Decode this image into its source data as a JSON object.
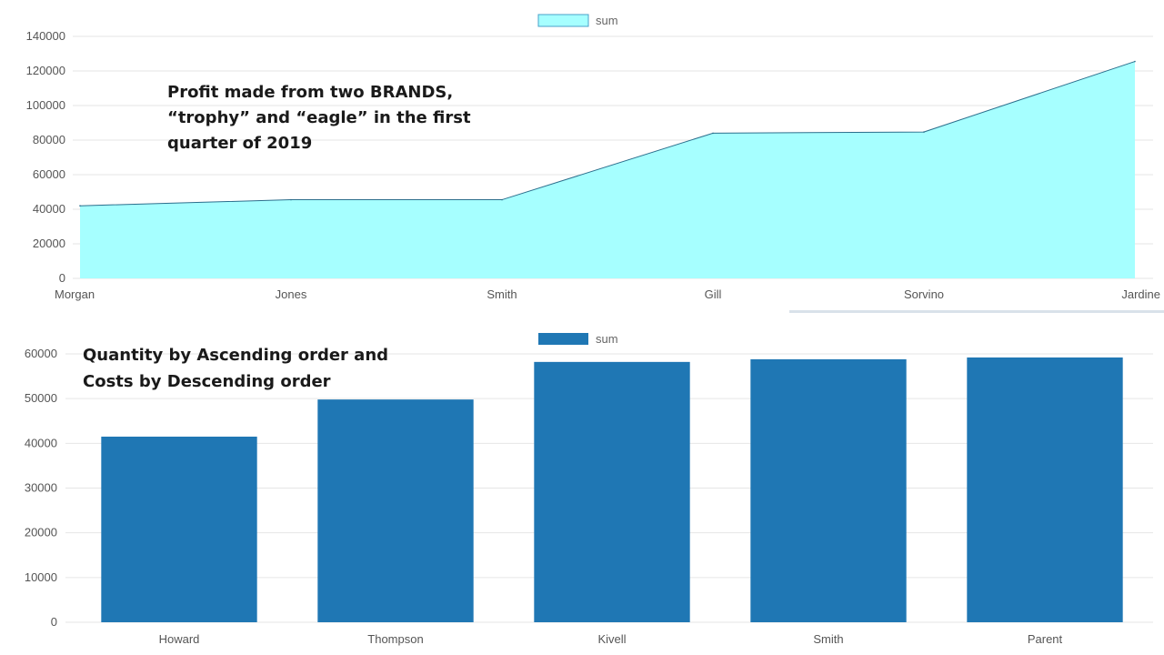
{
  "chart_data": [
    {
      "type": "area",
      "title": "",
      "legend": {
        "label": "sum",
        "placement": "top-center"
      },
      "categories": [
        "Morgan",
        "Jones",
        "Smith",
        "Gill",
        "Sorvino",
        "Jardine"
      ],
      "series": [
        {
          "name": "sum",
          "values": [
            42000,
            45500,
            45500,
            84000,
            84700,
            125500
          ]
        }
      ],
      "ylim": [
        0,
        140000
      ],
      "yticks": [
        0,
        20000,
        40000,
        60000,
        80000,
        100000,
        120000,
        140000
      ],
      "grid": true,
      "fill_color": "#a6ffff",
      "line_color": "#2b6e8c",
      "annotation": [
        "Profit made from two BRANDS,",
        "“trophy” and “eagle” in the first",
        "quarter of 2019"
      ]
    },
    {
      "type": "bar",
      "title": "",
      "legend": {
        "label": "sum",
        "placement": "top-center"
      },
      "categories": [
        "Howard",
        "Thompson",
        "Kivell",
        "Smith",
        "Parent"
      ],
      "series": [
        {
          "name": "sum",
          "values": [
            41500,
            49800,
            58200,
            58800,
            59200
          ]
        }
      ],
      "ylim": [
        0,
        60000
      ],
      "yticks": [
        0,
        10000,
        20000,
        30000,
        40000,
        50000,
        60000
      ],
      "grid": true,
      "bar_color": "#1f77b4",
      "annotation": [
        "Quantity by Ascending order and",
        "Costs by Descending order"
      ]
    }
  ]
}
